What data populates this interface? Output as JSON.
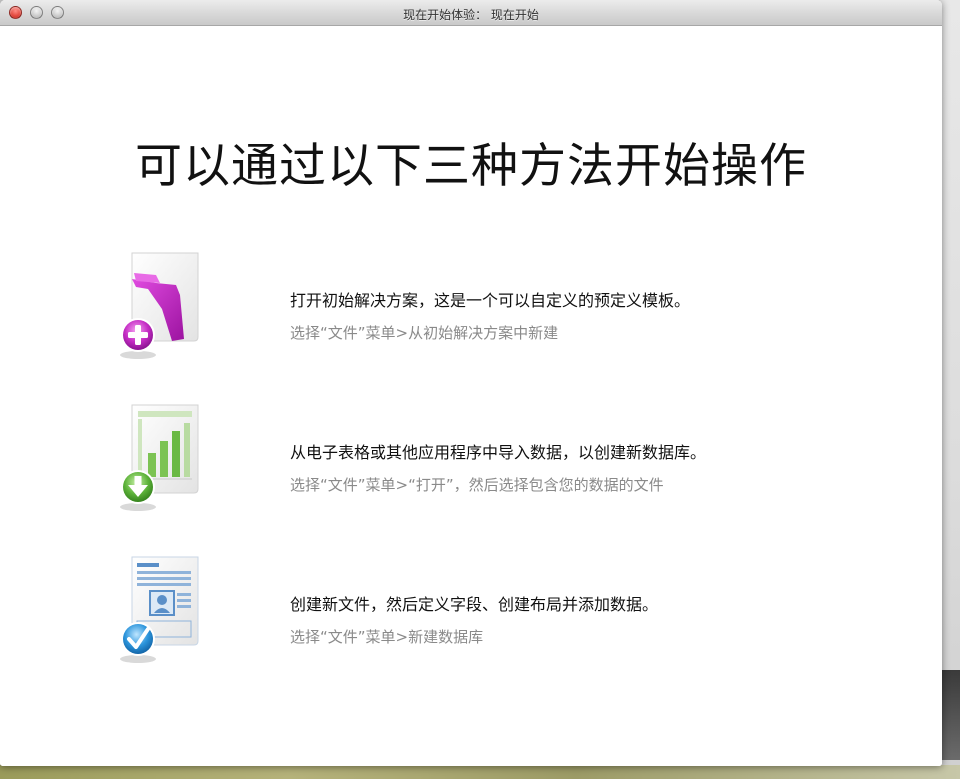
{
  "window": {
    "title": "现在开始体验： 现在开始"
  },
  "headline": "可以通过以下三种方法开始操作",
  "options": [
    {
      "icon": "starter-solution-plus-icon",
      "main": "打开初始解决方案，这是一个可以自定义的预定义模板。",
      "sub": "选择“文件”菜单>从初始解决方案中新建"
    },
    {
      "icon": "spreadsheet-import-icon",
      "main": "从电子表格或其他应用程序中导入数据，以创建新数据库。",
      "sub": "选择“文件”菜单>“打开”，然后选择包含您的数据的文件"
    },
    {
      "icon": "new-file-layout-check-icon",
      "main": "创建新文件，然后定义字段、创建布局并添加数据。",
      "sub": "选择“文件”菜单>新建数据库"
    }
  ],
  "colors": {
    "starter_accent": "#c21fc0",
    "import_accent": "#5aa83a",
    "new_file_accent": "#2c8fd6",
    "subtext": "#8a8a8a"
  }
}
